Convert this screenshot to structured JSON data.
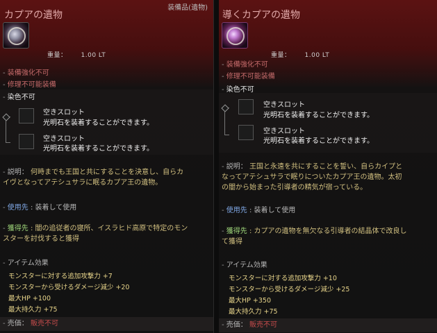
{
  "left": {
    "category": "装備品(遺物)",
    "title": "カプアの遺物",
    "weight_label": "重量：",
    "weight_value": "1.00 LT",
    "props": [
      "装備強化不可",
      "修理不可能装備"
    ],
    "dye": "染色不可",
    "slots": [
      {
        "title": "空きスロット",
        "desc": "光明石を装着することができます。"
      },
      {
        "title": "空きスロット",
        "desc": "光明石を装着することができます。"
      }
    ],
    "description_label": "説明：",
    "description_lines": [
      "何時までも王国と共にすることを決意し、自らカ",
      "イヴとなってアテシュサラに眠るカプア王の遺物。"
    ],
    "usage_label": "使用先",
    "usage_value": "装着して使用",
    "acquire_label": "獲得先",
    "acquire_lines": [
      "闇の追従者の寝所、イスラヒド高原で特定のモン",
      "スターを討伐すると獲得"
    ],
    "effects_label": "アイテム効果",
    "effects": [
      "モンスターに対する追加攻撃力 +7",
      "モンスターから受けるダメージ減少 +20",
      "最大HP +100",
      "最大持久力 +75"
    ],
    "sale_label": "売価：",
    "sale_value": "販売不可"
  },
  "right": {
    "title": "導くカプアの遺物",
    "weight_label": "重量：",
    "weight_value": "1.00 LT",
    "props": [
      "装備強化不可",
      "修理不可能装備"
    ],
    "dye": "染色不可",
    "slots": [
      {
        "title": "空きスロット",
        "desc": "光明石を装着することができます。"
      },
      {
        "title": "空きスロット",
        "desc": "光明石を装着することができます。"
      }
    ],
    "description_label": "説明：",
    "description_lines": [
      "王国と永遠を共にすることを誓い、自らカイプと",
      "なってアテシュサラで眠りについたカプア王の遺物。太初",
      "の闇から始まった引導者の精気が宿っている。"
    ],
    "usage_label": "使用先",
    "usage_value": "装着して使用",
    "acquire_label": "獲得先",
    "acquire_lines": [
      "カプアの遺物を無欠なる引導者の結晶体で改良し",
      "て獲得"
    ],
    "effects_label": "アイテム効果",
    "effects": [
      "モンスターに対する追加攻撃力 +10",
      "モンスターから受けるダメージ減少 +25",
      "最大HP +350",
      "最大持久力 +75"
    ],
    "sale_label": "売価：",
    "sale_value": "販売不可"
  }
}
